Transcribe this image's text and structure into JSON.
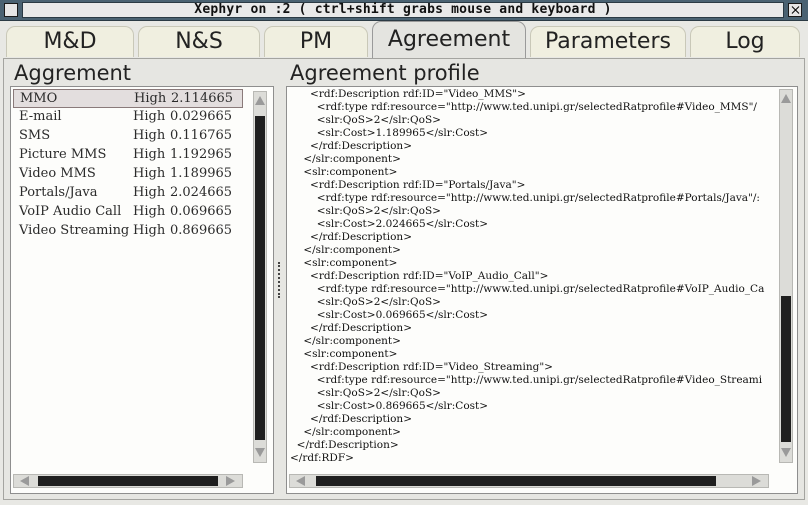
{
  "window": {
    "title": "Xephyr on :2 ( ctrl+shift grabs mouse and keyboard )"
  },
  "tabs": [
    {
      "label": "M&D"
    },
    {
      "label": "N&S"
    },
    {
      "label": "PM"
    },
    {
      "label": "Agreement",
      "active": true
    },
    {
      "label": "Parameters"
    },
    {
      "label": "Log"
    }
  ],
  "left": {
    "title": "Aggrement",
    "rows": [
      {
        "name": "MMO",
        "qos": "High",
        "cost": "2.114665",
        "selected": true
      },
      {
        "name": "E-mail",
        "qos": "High",
        "cost": "0.029665"
      },
      {
        "name": "SMS",
        "qos": "High",
        "cost": "0.116765"
      },
      {
        "name": "Picture MMS",
        "qos": "High",
        "cost": "1.192965"
      },
      {
        "name": "Video MMS",
        "qos": "High",
        "cost": "1.189965"
      },
      {
        "name": "Portals/Java",
        "qos": "High",
        "cost": "2.024665"
      },
      {
        "name": "VoIP Audio Call",
        "qos": "High",
        "cost": "0.069665"
      },
      {
        "name": "Video Streaming",
        "qos": "High",
        "cost": "0.869665"
      }
    ]
  },
  "right": {
    "title": "Agreement profile",
    "lines": [
      "      <rdf:Description rdf:ID=\"Video_MMS\">",
      "        <rdf:type rdf:resource=\"http://www.ted.unipi.gr/selectedRatprofile#Video_MMS\"/",
      "        <slr:QoS>2</slr:QoS>",
      "        <slr:Cost>1.189965</slr:Cost>",
      "      </rdf:Description>",
      "    </slr:component>",
      "    <slr:component>",
      "      <rdf:Description rdf:ID=\"Portals/Java\">",
      "        <rdf:type rdf:resource=\"http://www.ted.unipi.gr/selectedRatprofile#Portals/Java\"/:",
      "        <slr:QoS>2</slr:QoS>",
      "        <slr:Cost>2.024665</slr:Cost>",
      "      </rdf:Description>",
      "    </slr:component>",
      "    <slr:component>",
      "      <rdf:Description rdf:ID=\"VoIP_Audio_Call\">",
      "        <rdf:type rdf:resource=\"http://www.ted.unipi.gr/selectedRatprofile#VoIP_Audio_Ca",
      "        <slr:QoS>2</slr:QoS>",
      "        <slr:Cost>0.069665</slr:Cost>",
      "      </rdf:Description>",
      "    </slr:component>",
      "    <slr:component>",
      "      <rdf:Description rdf:ID=\"Video_Streaming\">",
      "        <rdf:type rdf:resource=\"http://www.ted.unipi.gr/selectedRatprofile#Video_Streami",
      "        <slr:QoS>2</slr:QoS>",
      "        <slr:Cost>0.869665</slr:Cost>",
      "      </rdf:Description>",
      "    </slr:component>",
      "  </rdf:Description>",
      "</rdf:RDF>"
    ]
  }
}
